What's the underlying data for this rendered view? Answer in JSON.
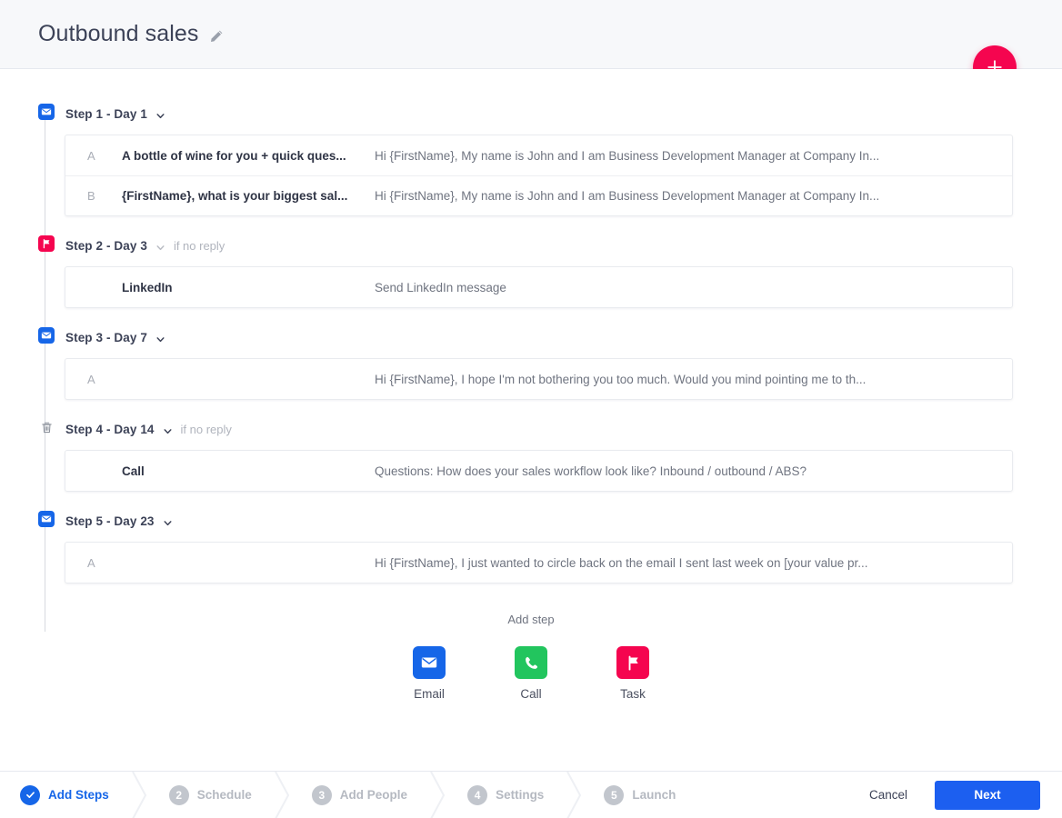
{
  "header": {
    "title": "Outbound sales",
    "edit_icon": "pencil-icon"
  },
  "fab": {
    "icon": "plus-icon",
    "color": "#f5054f"
  },
  "steps": [
    {
      "id": "step-1",
      "icon": "email-icon",
      "type": "email",
      "label": "Step 1 - Day 1",
      "condition": "",
      "rows": [
        {
          "variant": "A",
          "subject": "A bottle of wine for you + quick ques...",
          "preview": "Hi {FirstName},  My name is John and I am Business Development Manager at Company In..."
        },
        {
          "variant": "B",
          "subject": "{FirstName}, what is your biggest sal...",
          "preview": "Hi {FirstName},  My name is John and I am Business Development Manager at Company In..."
        }
      ]
    },
    {
      "id": "step-2",
      "icon": "flag-icon",
      "type": "task",
      "label": "Step 2 - Day 3",
      "condition": "if no reply",
      "rows": [
        {
          "variant": "",
          "subject": "LinkedIn",
          "preview": "Send LinkedIn message"
        }
      ]
    },
    {
      "id": "step-3",
      "icon": "email-icon",
      "type": "email",
      "label": "Step 3 - Day 7",
      "condition": "",
      "rows": [
        {
          "variant": "A",
          "subject": "",
          "preview": "Hi {FirstName},  I hope I'm not bothering you too much. Would you mind pointing me to th..."
        }
      ]
    },
    {
      "id": "step-4",
      "icon": "trash-icon",
      "type": "trash",
      "label": "Step 4 - Day 14",
      "condition": "if no reply",
      "rows": [
        {
          "variant": "",
          "subject": "Call",
          "preview": "Questions: How does your sales workflow look like? Inbound / outbound / ABS?"
        }
      ]
    },
    {
      "id": "step-5",
      "icon": "email-icon",
      "type": "email",
      "label": "Step 5 - Day 23",
      "condition": "",
      "rows": [
        {
          "variant": "A",
          "subject": "",
          "preview": "Hi {FirstName},  I just wanted to circle back on the email I sent last week on [your value pr..."
        }
      ]
    }
  ],
  "add_step": {
    "title": "Add step",
    "tiles": [
      {
        "label": "Email",
        "icon": "envelope-icon",
        "color": "#1666e8",
        "type": "email"
      },
      {
        "label": "Call",
        "icon": "phone-icon",
        "color": "#22c55e",
        "type": "call"
      },
      {
        "label": "Task",
        "icon": "flag-icon",
        "color": "#f5054f",
        "type": "task"
      }
    ]
  },
  "footer": {
    "nav": [
      {
        "number": "1",
        "label": "Add Steps",
        "state": "done"
      },
      {
        "number": "2",
        "label": "Schedule",
        "state": "pending"
      },
      {
        "number": "3",
        "label": "Add People",
        "state": "pending"
      },
      {
        "number": "4",
        "label": "Settings",
        "state": "pending"
      },
      {
        "number": "5",
        "label": "Launch",
        "state": "pending"
      }
    ],
    "cancel_label": "Cancel",
    "next_label": "Next"
  }
}
